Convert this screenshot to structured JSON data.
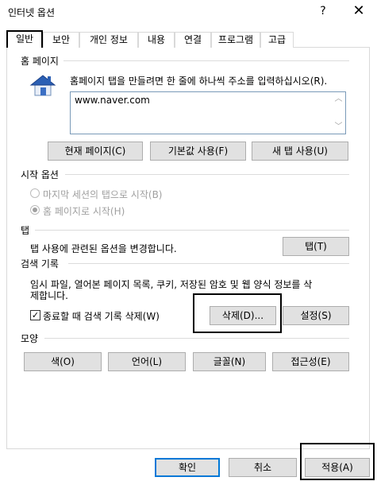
{
  "window": {
    "title": "인터넷 옵션",
    "help_glyph": "?",
    "close_glyph": "✕"
  },
  "tabs": [
    {
      "label": "일반",
      "active": true
    },
    {
      "label": "보안"
    },
    {
      "label": "개인 정보"
    },
    {
      "label": "내용"
    },
    {
      "label": "연결"
    },
    {
      "label": "프로그램"
    },
    {
      "label": "고급"
    }
  ],
  "home_page": {
    "section_label": "홈 페이지",
    "icon": "home-icon",
    "description": "홈페이지 탭을 만들려면 한 줄에 하나씩 주소를 입력하십시오(R).",
    "url_value": "www.naver.com",
    "buttons": {
      "current": "현재 페이지(C)",
      "default": "기본값 사용(F)",
      "new_tab": "새 탭 사용(U)"
    }
  },
  "startup": {
    "section_label": "시작 옵션",
    "option_last_session": "마지막 세션의 탭으로 시작(B)",
    "option_home_page": "홈 페이지로 시작(H)",
    "selected": "home_page"
  },
  "tabs_section": {
    "section_label": "탭",
    "description": "탭 사용에 관련된 옵션을 변경합니다.",
    "button": "탭(T)"
  },
  "history": {
    "section_label": "검색 기록",
    "description_line1": "임시 파일, 열어본 페이지 목록, 쿠키, 저장된 암호 및 웹 양식 정보를 삭",
    "description_line2": "제합니다.",
    "checkbox_label": "종료할 때 검색 기록 삭제(W)",
    "checkbox_checked": true,
    "delete_button": "삭제(D)...",
    "settings_button": "설정(S)"
  },
  "appearance": {
    "section_label": "모양",
    "colors": "색(O)",
    "languages": "언어(L)",
    "fonts": "글꼴(N)",
    "accessibility": "접근성(E)"
  },
  "footer": {
    "ok": "확인",
    "cancel": "취소",
    "apply": "적용(A)"
  },
  "colors": {
    "focus_border": "#0078d7",
    "button_bg": "#e1e1e1",
    "house_roof": "#2b5fb4",
    "house_wall": "#e8eef8"
  }
}
